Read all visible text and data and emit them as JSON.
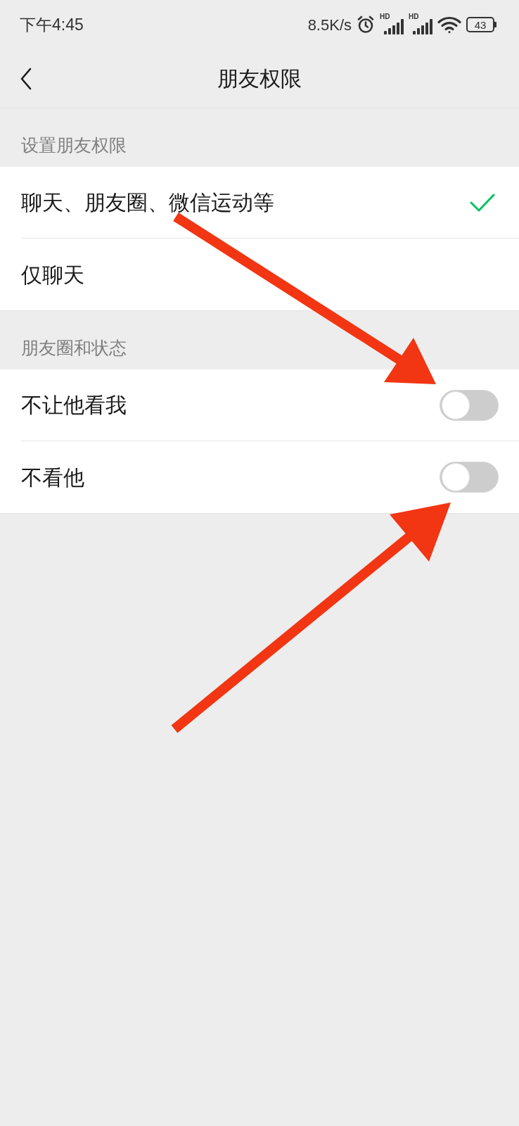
{
  "status_bar": {
    "time": "下午4:45",
    "net_speed": "8.5K/s",
    "signals": [
      {
        "badge": "HD"
      },
      {
        "badge": "HD"
      }
    ],
    "battery": "43"
  },
  "header": {
    "title": "朋友权限"
  },
  "sections": [
    {
      "title": "设置朋友权限",
      "items": [
        {
          "kind": "choice",
          "label": "聊天、朋友圈、微信运动等",
          "selected": true
        },
        {
          "kind": "choice",
          "label": "仅聊天",
          "selected": false
        }
      ]
    },
    {
      "title": "朋友圈和状态",
      "items": [
        {
          "kind": "toggle",
          "label": "不让他看我",
          "on": false
        },
        {
          "kind": "toggle",
          "label": "不看他",
          "on": false
        }
      ]
    }
  ]
}
